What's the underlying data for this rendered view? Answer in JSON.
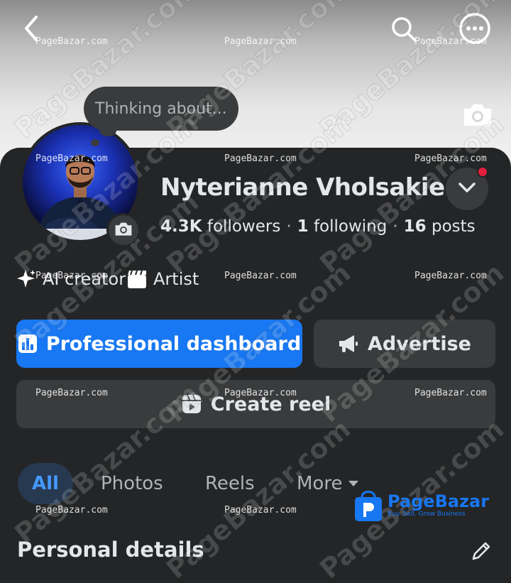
{
  "header": {
    "back_icon": "chevron-left-icon",
    "search_icon": "search-icon",
    "more_icon": "more-horizontal-icon",
    "cover_camera_icon": "camera-icon"
  },
  "thought": {
    "text": "Thinking about..."
  },
  "profile": {
    "name": "Nyterianne Vholsakie",
    "followers": "4.3K",
    "followers_label": "followers",
    "following": "1",
    "following_label": "following",
    "posts": "16",
    "posts_label": "posts",
    "separator": "·",
    "notification_color": "#e41e3f"
  },
  "tags": [
    {
      "label": "AI creator",
      "icon": "sparkle-icon"
    },
    {
      "label": "Artist",
      "icon": "clapperboard-icon"
    }
  ],
  "actions": {
    "professional_dashboard": "Professional dashboard",
    "advertise": "Advertise",
    "create_reel": "Create reel"
  },
  "tabs": [
    {
      "label": "All",
      "active": true
    },
    {
      "label": "Photos",
      "active": false
    },
    {
      "label": "Reels",
      "active": false
    },
    {
      "label": "More",
      "active": false
    }
  ],
  "section": {
    "title": "Personal details"
  },
  "colors": {
    "accent": "#1877f2",
    "background": "#242526",
    "surface": "#3a3b3c",
    "tab_active_text": "#4599ff"
  },
  "watermark": {
    "small_text": "PageBazar.com",
    "big_text": "PageBazar.com",
    "logo_name": "PageBazar",
    "logo_tagline": "Buy. Sell. Grow Business"
  }
}
